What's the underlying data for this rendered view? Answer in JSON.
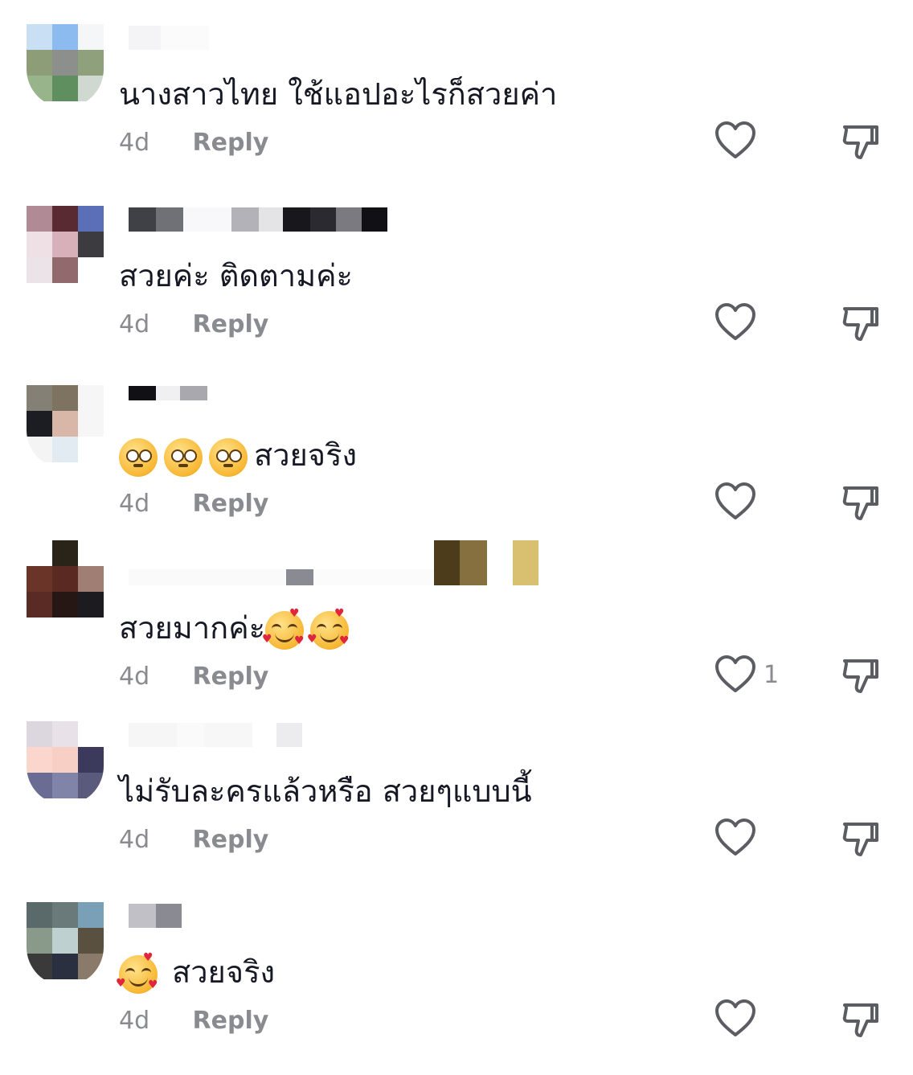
{
  "comments": [
    {
      "text": "นางสาวไทย ใช้แอปอะไรก็สวยค่า",
      "date": "4d",
      "reply_label": "Reply",
      "like_count": ""
    },
    {
      "text": "สวยค่ะ ติดตามค่ะ",
      "date": "4d",
      "reply_label": "Reply",
      "like_count": ""
    },
    {
      "text": "สวยจริง",
      "date": "4d",
      "reply_label": "Reply",
      "like_count": "",
      "emoji_prefix": [
        "flushed-face",
        "flushed-face",
        "flushed-face"
      ]
    },
    {
      "text": "สวยมากค่ะ",
      "date": "4d",
      "reply_label": "Reply",
      "like_count": "1",
      "emoji_suffix": [
        "smiling-face-with-hearts",
        "smiling-face-with-hearts"
      ]
    },
    {
      "text": "ไม่รับละครแล้วหรือ สวยๆแบบนี้",
      "date": "4d",
      "reply_label": "Reply",
      "like_count": ""
    },
    {
      "text": "สวยจริง",
      "date": "4d",
      "reply_label": "Reply",
      "like_count": "",
      "emoji_prefix": [
        "smiling-face-with-hearts"
      ]
    }
  ],
  "icons": {
    "like": "heart-outline-icon",
    "dislike": "thumbs-down-outline-icon"
  },
  "colors": {
    "comment_text": "#161823",
    "meta_text": "#8a8b91",
    "icon_stroke": "#5c5c63"
  }
}
